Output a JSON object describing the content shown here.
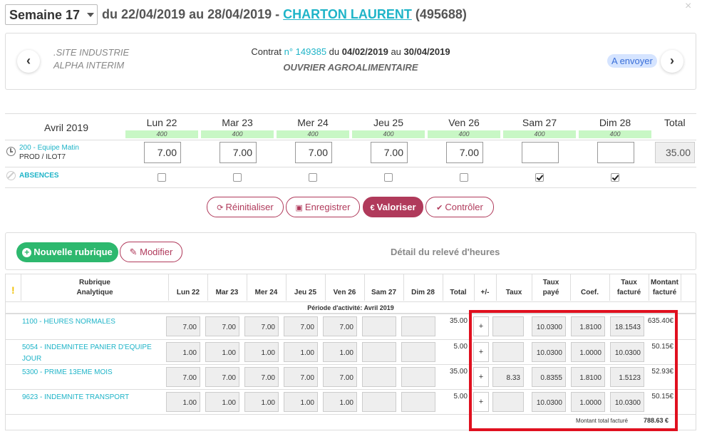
{
  "header": {
    "week_label": "Semaine 17",
    "date_range": "du 22/04/2019 au 28/04/2019 - ",
    "employee_name": "CHARTON LAURENT",
    "employee_id": "(495688)",
    "close": "×"
  },
  "contract": {
    "company_line1": ".SITE INDUSTRIE",
    "company_line2": "ALPHA INTERIM",
    "contract_prefix": "Contrat ",
    "contract_number": "n° 149385",
    "contract_from_prefix": " du ",
    "contract_from": "04/02/2019",
    "contract_to_prefix": " au ",
    "contract_to": "30/04/2019",
    "job_title": "OUVRIER AGROALIMENTAIRE",
    "status": "A envoyer",
    "prev_icon": "‹",
    "next_icon": "›"
  },
  "week": {
    "month": "Avril 2019",
    "total_label": "Total",
    "days": [
      {
        "label": "Lun 22",
        "cap": "400",
        "hours": "7.00",
        "absence": false
      },
      {
        "label": "Mar 23",
        "cap": "400",
        "hours": "7.00",
        "absence": false
      },
      {
        "label": "Mer 24",
        "cap": "400",
        "hours": "7.00",
        "absence": false
      },
      {
        "label": "Jeu 25",
        "cap": "400",
        "hours": "7.00",
        "absence": false
      },
      {
        "label": "Ven 26",
        "cap": "400",
        "hours": "7.00",
        "absence": false
      },
      {
        "label": "Sam 27",
        "cap": "400",
        "hours": "",
        "absence": true
      },
      {
        "label": "Dim 28",
        "cap": "400",
        "hours": "",
        "absence": true
      }
    ],
    "team_label": "200 - Equipe Matin",
    "team_sub": "PROD / ILOT7",
    "total_hours": "35.00",
    "absences_label": "ABSENCES"
  },
  "actions": {
    "reset": "Réinitialiser",
    "save": "Enregistrer",
    "valorize": "Valoriser",
    "control": "Contrôler"
  },
  "detail": {
    "new_rubric": "Nouvelle rubrique",
    "modify": "Modifier",
    "title": "Détail du relevé d'heures"
  },
  "table": {
    "headers": {
      "rubrique": "Rubrique",
      "analytique": "Analytique",
      "lun": "Lun 22",
      "mar": "Mar 23",
      "mer": "Mer 24",
      "jeu": "Jeu 25",
      "ven": "Ven 26",
      "sam": "Sam 27",
      "dim": "Dim 28",
      "total": "Total",
      "pm": "+/-",
      "taux": "Taux",
      "taux_paye_1": "Taux",
      "taux_paye_2": "payé",
      "coef": "Coef.",
      "taux_facture_1": "Taux",
      "taux_facture_2": "facturé",
      "montant_1": "Montant",
      "montant_2": "facturé"
    },
    "period": "Période d'activité: Avril 2019",
    "rows": [
      {
        "name_l1": "1100 - HEURES NORMALES",
        "name_l2": "",
        "days": [
          "7.00",
          "7.00",
          "7.00",
          "7.00",
          "7.00",
          "",
          ""
        ],
        "total": "35.00",
        "pm": "+",
        "taux": "",
        "taux_paye": "10.0300",
        "coef": "1.8100",
        "taux_facture": "18.1543",
        "montant": "635.40€"
      },
      {
        "name_l1": "5054 - INDEMNITEE PANIER D'EQUIPE",
        "name_l2": "JOUR",
        "days": [
          "1.00",
          "1.00",
          "1.00",
          "1.00",
          "1.00",
          "",
          ""
        ],
        "total": "5.00",
        "pm": "+",
        "taux": "",
        "taux_paye": "10.0300",
        "coef": "1.0000",
        "taux_facture": "10.0300",
        "montant": "50.15€"
      },
      {
        "name_l1": "5300 - PRIME 13EME MOIS",
        "name_l2": "",
        "days": [
          "7.00",
          "7.00",
          "7.00",
          "7.00",
          "7.00",
          "",
          ""
        ],
        "total": "35.00",
        "pm": "+",
        "taux": "8.33",
        "taux_paye": "0.8355",
        "coef": "1.8100",
        "taux_facture": "1.5123",
        "montant": "52.93€"
      },
      {
        "name_l1": "9623 - INDEMNITE TRANSPORT",
        "name_l2": "",
        "days": [
          "1.00",
          "1.00",
          "1.00",
          "1.00",
          "1.00",
          "",
          ""
        ],
        "total": "5.00",
        "pm": "+",
        "taux": "",
        "taux_paye": "10.0300",
        "coef": "1.0000",
        "taux_facture": "10.0300",
        "montant": "50.15€"
      }
    ],
    "total_label": "Montant total facturé",
    "total_value": "788.63 €"
  },
  "colors": {
    "accent": "#1fb4c8",
    "primary": "#b03a5b",
    "success": "#2db86e",
    "highlight": "#e0101f"
  }
}
